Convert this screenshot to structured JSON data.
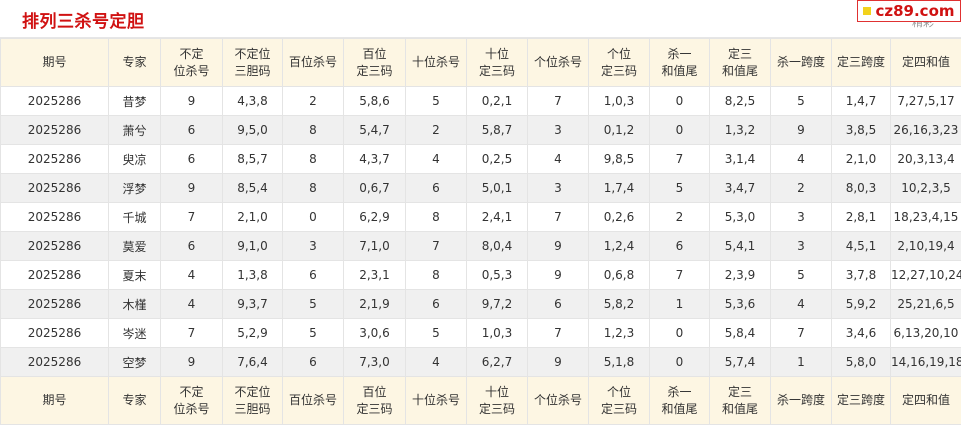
{
  "page": {
    "title": "排列三杀号定胆",
    "logo_text": "cz89.com",
    "more_link": "精彩"
  },
  "table": {
    "headers": [
      [
        "期号"
      ],
      [
        "专家"
      ],
      [
        "不定",
        "位杀号"
      ],
      [
        "不定位",
        "三胆码"
      ],
      [
        "百位杀号"
      ],
      [
        "百位",
        "定三码"
      ],
      [
        "十位杀号"
      ],
      [
        "十位",
        "定三码"
      ],
      [
        "个位杀号"
      ],
      [
        "个位",
        "定三码"
      ],
      [
        "杀一",
        "和值尾"
      ],
      [
        "定三",
        "和值尾"
      ],
      [
        "杀一跨度"
      ],
      [
        "定三跨度"
      ],
      [
        "定四和值"
      ]
    ],
    "rows": [
      [
        "2025286",
        "昔梦",
        "9",
        "4,3,8",
        "2",
        "5,8,6",
        "5",
        "0,2,1",
        "7",
        "1,0,3",
        "0",
        "8,2,5",
        "5",
        "1,4,7",
        "7,27,5,17"
      ],
      [
        "2025286",
        "萧兮",
        "6",
        "9,5,0",
        "8",
        "5,4,7",
        "2",
        "5,8,7",
        "3",
        "0,1,2",
        "0",
        "1,3,2",
        "9",
        "3,8,5",
        "26,16,3,23"
      ],
      [
        "2025286",
        "臾凉",
        "6",
        "8,5,7",
        "8",
        "4,3,7",
        "4",
        "0,2,5",
        "4",
        "9,8,5",
        "7",
        "3,1,4",
        "4",
        "2,1,0",
        "20,3,13,4"
      ],
      [
        "2025286",
        "浮梦",
        "9",
        "8,5,4",
        "8",
        "0,6,7",
        "6",
        "5,0,1",
        "3",
        "1,7,4",
        "5",
        "3,4,7",
        "2",
        "8,0,3",
        "10,2,3,5"
      ],
      [
        "2025286",
        "千城",
        "7",
        "2,1,0",
        "0",
        "6,2,9",
        "8",
        "2,4,1",
        "7",
        "0,2,6",
        "2",
        "5,3,0",
        "3",
        "2,8,1",
        "18,23,4,15"
      ],
      [
        "2025286",
        "莫爱",
        "6",
        "9,1,0",
        "3",
        "7,1,0",
        "7",
        "8,0,4",
        "9",
        "1,2,4",
        "6",
        "5,4,1",
        "3",
        "4,5,1",
        "2,10,19,4"
      ],
      [
        "2025286",
        "夏末",
        "4",
        "1,3,8",
        "6",
        "2,3,1",
        "8",
        "0,5,3",
        "9",
        "0,6,8",
        "7",
        "2,3,9",
        "5",
        "3,7,8",
        "12,27,10,24"
      ],
      [
        "2025286",
        "木槿",
        "4",
        "9,3,7",
        "5",
        "2,1,9",
        "6",
        "9,7,2",
        "6",
        "5,8,2",
        "1",
        "5,3,6",
        "4",
        "5,9,2",
        "25,21,6,5"
      ],
      [
        "2025286",
        "岑迷",
        "7",
        "5,2,9",
        "5",
        "3,0,6",
        "5",
        "1,0,3",
        "7",
        "1,2,3",
        "0",
        "5,8,4",
        "7",
        "3,4,6",
        "6,13,20,10"
      ],
      [
        "2025286",
        "空梦",
        "9",
        "7,6,4",
        "6",
        "7,3,0",
        "4",
        "6,2,7",
        "9",
        "5,1,8",
        "0",
        "5,7,4",
        "1",
        "5,8,0",
        "14,16,19,18"
      ]
    ]
  },
  "colors": {
    "title_red": "#d01212",
    "header_bg": "#fdf6e3",
    "row_alt_bg": "#f0f0f0",
    "border": "#e4e4e4",
    "logo_dot": "#f2d21c"
  }
}
